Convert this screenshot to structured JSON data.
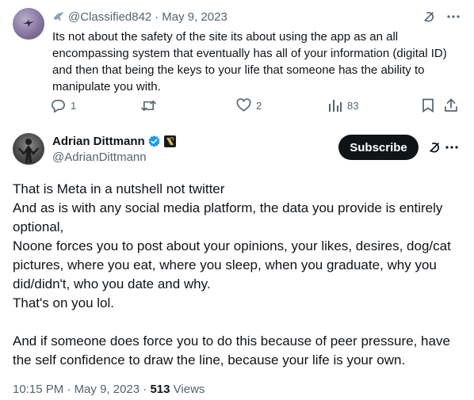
{
  "reply": {
    "handle": "@Classified842",
    "separator": "·",
    "date": "May 9, 2023",
    "text": "Its not about the safety of the site its about using the app as an all encompassing system that eventually has all of your information (digital ID) and then that being the keys to your life that someone has the ability to manipulate you with.",
    "replies": "1",
    "retweets": "",
    "likes": "2",
    "views": "83"
  },
  "tweet": {
    "display_name": "Adrian Dittmann",
    "handle": "@AdrianDittmann",
    "subscribe_label": "Subscribe",
    "lines": [
      "That is Meta in a nutshell not twitter",
      "And as is with any social media platform, the data you provide is entirely optional,",
      "Noone forces you to post about your opinions, your likes, desires, dog/cat pictures, where you eat, where you sleep, when you graduate, why you did/didn't, who you date and why.",
      "That's on you lol.",
      "And if someone does force you to do this because of peer pressure, have the self confidence to draw the line, because your life is your own."
    ],
    "time": "10:15 PM",
    "separator": "·",
    "date": "May 9, 2023",
    "separator2": "·",
    "views_count": "513",
    "views_label": "Views"
  },
  "colors": {
    "text": "#0f1419",
    "secondary": "#536471",
    "verified_blue": "#1d9bf0",
    "button_bg": "#0f1419",
    "button_text": "#ffffff"
  },
  "icons": {
    "reply_verified": "grey-bird-badge-icon",
    "reply": "comment-icon",
    "retweet": "retweet-icon",
    "like": "heart-icon",
    "views": "bar-chart-icon",
    "bookmark": "bookmark-icon",
    "share": "share-icon",
    "grok": "grok-icon",
    "more": "more-dots-icon",
    "verified": "verified-badge-icon",
    "affiliate": "affiliate-badge-icon"
  }
}
